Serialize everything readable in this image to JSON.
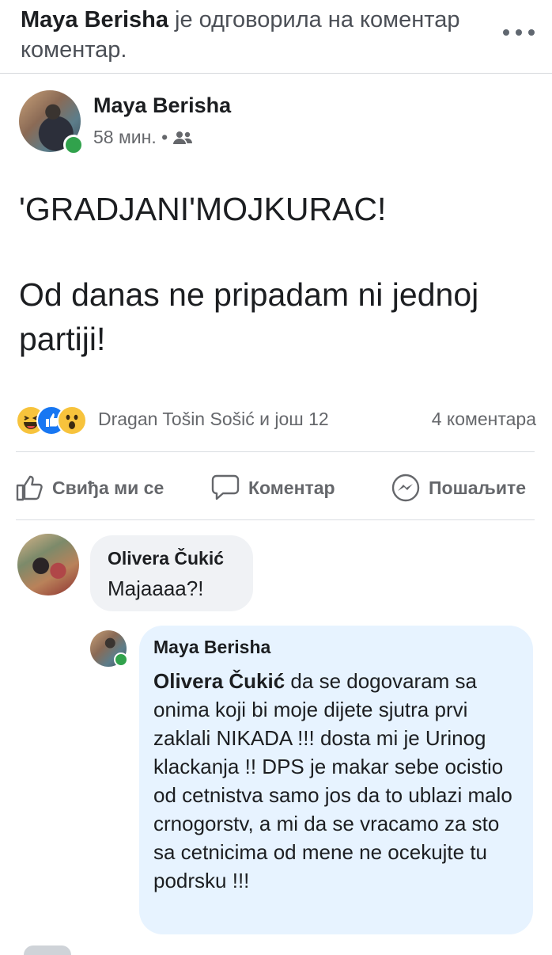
{
  "notification": {
    "actor": "Maya Berisha",
    "text": " је одговорила на коментар коментар."
  },
  "post": {
    "author": "Maya Berisha",
    "time": "58 мин. •",
    "audience_icon": "friends-icon",
    "lines": [
      "'GRADJANI'MOJKURAC!",
      "Od danas ne pripadam ni jednoj partiji!"
    ]
  },
  "reactions": {
    "icons": [
      "haha",
      "like",
      "wow"
    ],
    "names": "Dragan Tošin Sošić и још 12",
    "comments": "4 коментара"
  },
  "actions": {
    "like": "Свиђа ми се",
    "comment": "Коментар",
    "send": "Пошаљите"
  },
  "comment": {
    "author": "Olivera Čukić",
    "text": "Majaaaa?!"
  },
  "reply": {
    "author": "Maya Berisha",
    "mention": "Olivera Čukić",
    "text": " da se dogovaram sa onima koji bi moje dijete sjutra prvi zaklali NIKADA !!! dosta mi je Urinog klackanja !! DPS je makar sebe ocistio od cetnistva samo jos da to ublazi malo crnogorstv, a mi da se vracamo za sto sa cetnicima od mene ne ocekujte tu podrsku !!!"
  },
  "colors": {
    "link_blue": "#1877f2",
    "online_green": "#31a24c",
    "reply_bubble": "#e7f3ff",
    "comment_bubble": "#f0f2f5"
  }
}
